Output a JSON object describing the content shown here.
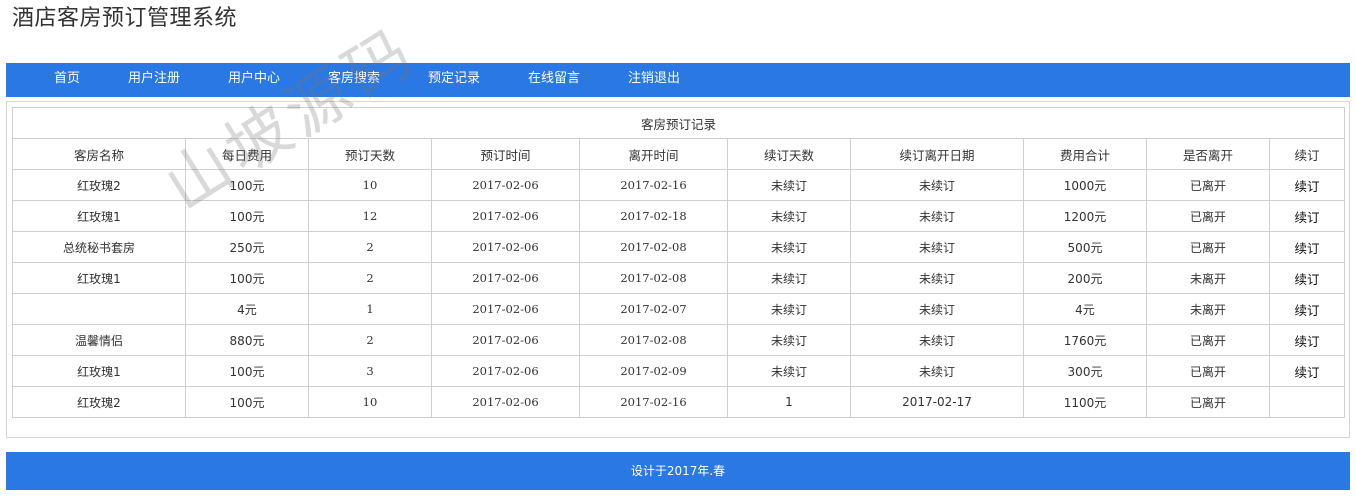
{
  "site": {
    "title": "酒店客房预订管理系统"
  },
  "nav": {
    "items": [
      {
        "id": "home",
        "label": "首页"
      },
      {
        "id": "register",
        "label": "用户注册"
      },
      {
        "id": "user-center",
        "label": "用户中心"
      },
      {
        "id": "room-search",
        "label": "客房搜索"
      },
      {
        "id": "booking-records",
        "label": "预定记录"
      },
      {
        "id": "messages",
        "label": "在线留言"
      },
      {
        "id": "logout",
        "label": "注销退出"
      }
    ]
  },
  "records": {
    "caption": "客房预订记录",
    "columns": [
      "客房名称",
      "每日费用",
      "预订天数",
      "预订时间",
      "离开时间",
      "续订天数",
      "续订离开日期",
      "费用合计",
      "是否离开",
      "续订"
    ],
    "rows": [
      {
        "room": "红玫瑰2",
        "daily_fee": "100元",
        "days": "10",
        "booked": "2017-02-06",
        "leave": "2017-02-16",
        "renew_days": "未续订",
        "renew_leave": "未续订",
        "total": "1000元",
        "left": "已离开",
        "action": "续订"
      },
      {
        "room": "红玫瑰1",
        "daily_fee": "100元",
        "days": "12",
        "booked": "2017-02-06",
        "leave": "2017-02-18",
        "renew_days": "未续订",
        "renew_leave": "未续订",
        "total": "1200元",
        "left": "已离开",
        "action": "续订"
      },
      {
        "room": "总统秘书套房",
        "daily_fee": "250元",
        "days": "2",
        "booked": "2017-02-06",
        "leave": "2017-02-08",
        "renew_days": "未续订",
        "renew_leave": "未续订",
        "total": "500元",
        "left": "已离开",
        "action": "续订"
      },
      {
        "room": "红玫瑰1",
        "daily_fee": "100元",
        "days": "2",
        "booked": "2017-02-06",
        "leave": "2017-02-08",
        "renew_days": "未续订",
        "renew_leave": "未续订",
        "total": "200元",
        "left": "未离开",
        "action": "续订"
      },
      {
        "room": "",
        "daily_fee": "4元",
        "days": "1",
        "booked": "2017-02-06",
        "leave": "2017-02-07",
        "renew_days": "未续订",
        "renew_leave": "未续订",
        "total": "4元",
        "left": "未离开",
        "action": "续订"
      },
      {
        "room": "温馨情侣",
        "daily_fee": "880元",
        "days": "2",
        "booked": "2017-02-06",
        "leave": "2017-02-08",
        "renew_days": "未续订",
        "renew_leave": "未续订",
        "total": "1760元",
        "left": "已离开",
        "action": "续订"
      },
      {
        "room": "红玫瑰1",
        "daily_fee": "100元",
        "days": "3",
        "booked": "2017-02-06",
        "leave": "2017-02-09",
        "renew_days": "未续订",
        "renew_leave": "未续订",
        "total": "300元",
        "left": "已离开",
        "action": "续订"
      },
      {
        "room": "红玫瑰2",
        "daily_fee": "100元",
        "days": "10",
        "booked": "2017-02-06",
        "leave": "2017-02-16",
        "renew_days": "1",
        "renew_leave": "2017-02-17",
        "total": "1100元",
        "left": "已离开",
        "action": ""
      }
    ]
  },
  "footer": {
    "text": "设计于2017年.春"
  },
  "watermark": {
    "text": "山坡源码"
  }
}
